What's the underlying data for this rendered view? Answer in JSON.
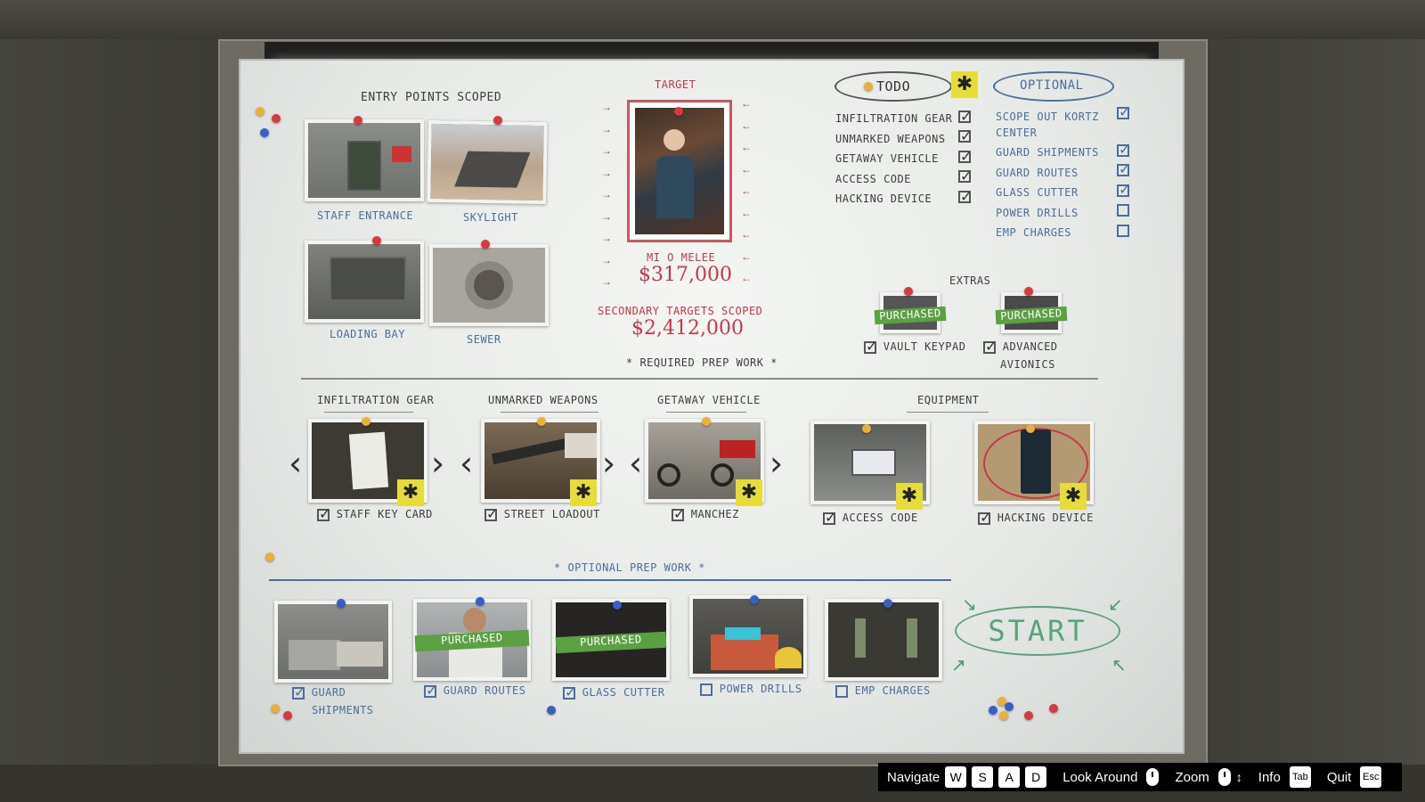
{
  "board": {
    "entry_title": "ENTRY POINTS SCOPED",
    "entry_points": [
      {
        "label": "STAFF ENTRANCE"
      },
      {
        "label": "SKYLIGHT"
      },
      {
        "label": "LOADING BAY"
      },
      {
        "label": "SEWER"
      }
    ],
    "target_title": "TARGET",
    "target_name": "MI O MELEE",
    "target_value": "$317,000",
    "secondary_title": "SECONDARY TARGETS SCOPED",
    "secondary_value": "$2,412,000",
    "todo": {
      "title": "TODO",
      "items": [
        {
          "label": "INFILTRATION GEAR",
          "checked": true
        },
        {
          "label": "UNMARKED WEAPONS",
          "checked": true
        },
        {
          "label": "GETAWAY VEHICLE",
          "checked": true
        },
        {
          "label": "ACCESS CODE",
          "checked": true
        },
        {
          "label": "HACKING DEVICE",
          "checked": true
        }
      ]
    },
    "optional": {
      "title": "OPTIONAL",
      "items": [
        {
          "label": "SCOPE OUT KORTZ",
          "label2": "CENTER",
          "checked": true
        },
        {
          "label": "GUARD SHIPMENTS",
          "checked": true
        },
        {
          "label": "GUARD ROUTES",
          "checked": true
        },
        {
          "label": "GLASS CUTTER",
          "checked": true
        },
        {
          "label": "POWER DRILLS",
          "checked": false
        },
        {
          "label": "EMP CHARGES",
          "checked": false
        }
      ]
    },
    "extras": {
      "title": "EXTRAS",
      "items": [
        {
          "label": "VAULT KEYPAD",
          "tag": "PURCHASED",
          "checked": true
        },
        {
          "label": "ADVANCED",
          "label2": "AVIONICS",
          "tag": "PURCHASED",
          "checked": true
        }
      ]
    },
    "required_title": "* REQUIRED PREP WORK *",
    "required": [
      {
        "category": "INFILTRATION GEAR",
        "label": "STAFF KEY CARD",
        "checked": true
      },
      {
        "category": "UNMARKED WEAPONS",
        "label": "STREET LOADOUT",
        "checked": true
      },
      {
        "category": "GETAWAY VEHICLE",
        "label": "MANCHEZ",
        "checked": true
      },
      {
        "category": "EQUIPMENT",
        "label": "ACCESS CODE",
        "checked": true
      },
      {
        "category": "",
        "label": "HACKING DEVICE",
        "checked": true
      }
    ],
    "optional_title": "* OPTIONAL PREP WORK *",
    "optional_prep": [
      {
        "label": "GUARD",
        "label2": "SHIPMENTS",
        "checked": true,
        "tag": ""
      },
      {
        "label": "GUARD ROUTES",
        "checked": true,
        "tag": "PURCHASED"
      },
      {
        "label": "GLASS CUTTER",
        "checked": true,
        "tag": "PURCHASED"
      },
      {
        "label": "POWER DRILLS",
        "checked": false,
        "tag": ""
      },
      {
        "label": "EMP CHARGES",
        "checked": false,
        "tag": ""
      }
    ],
    "start_label": "START",
    "star_symbol": "✱"
  },
  "hud": {
    "navigate": "Navigate",
    "keys_nav": [
      "W",
      "S",
      "A",
      "D"
    ],
    "look": "Look Around",
    "zoom": "Zoom",
    "info": "Info",
    "info_key": "Tab",
    "quit": "Quit",
    "quit_key": "Esc"
  }
}
